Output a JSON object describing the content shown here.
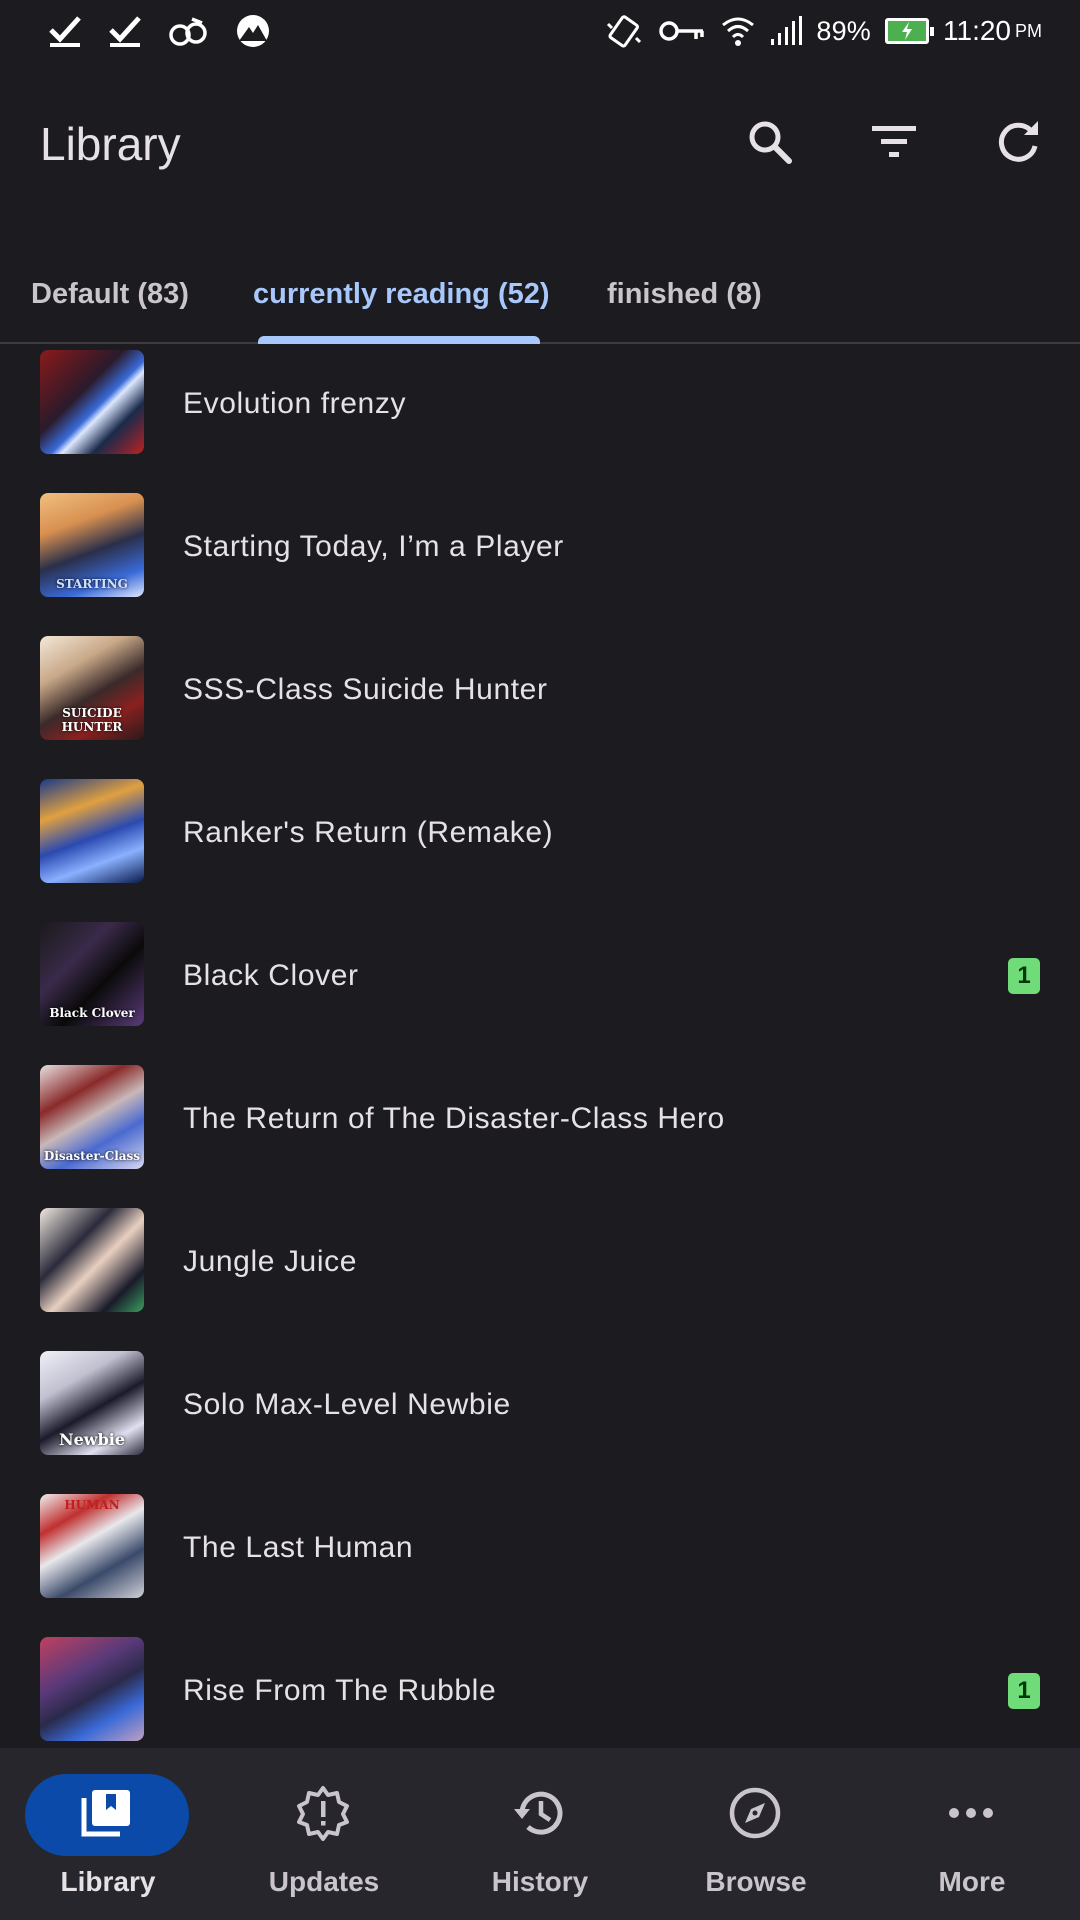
{
  "status_bar": {
    "battery": "89%",
    "time": "11:20",
    "ampm": "PM"
  },
  "app_bar": {
    "title": "Library",
    "actions": [
      "search-icon",
      "filter-icon",
      "refresh-icon"
    ]
  },
  "tabs": [
    {
      "label": "Default (83)",
      "active": false
    },
    {
      "label": "currently reading (52)",
      "active": true
    },
    {
      "label": "finished (8)",
      "active": false
    }
  ],
  "library_items": [
    {
      "title": "Evolution frenzy",
      "badge": null
    },
    {
      "title": "Starting Today, I’m a Player",
      "badge": null
    },
    {
      "title": "SSS-Class Suicide Hunter",
      "badge": null
    },
    {
      "title": "Ranker's Return (Remake)",
      "badge": null
    },
    {
      "title": "Black Clover",
      "badge": "1"
    },
    {
      "title": "The Return of The Disaster-Class Hero",
      "badge": null
    },
    {
      "title": "Jungle Juice",
      "badge": null
    },
    {
      "title": "Solo Max-Level Newbie",
      "badge": null
    },
    {
      "title": "The Last Human",
      "badge": null
    },
    {
      "title": "Rise From The Rubble",
      "badge": "1"
    }
  ],
  "bottom_nav": [
    {
      "label": "Library",
      "icon": "library-icon",
      "active": true
    },
    {
      "label": "Updates",
      "icon": "updates-icon",
      "active": false
    },
    {
      "label": "History",
      "icon": "history-icon",
      "active": false
    },
    {
      "label": "Browse",
      "icon": "browse-icon",
      "active": false
    },
    {
      "label": "More",
      "icon": "more-icon",
      "active": false
    }
  ],
  "colors": {
    "background": "#1c1b1f",
    "accent": "#a8c7fa",
    "nav_active": "#0b4aa8",
    "badge": "#6fdc79"
  }
}
